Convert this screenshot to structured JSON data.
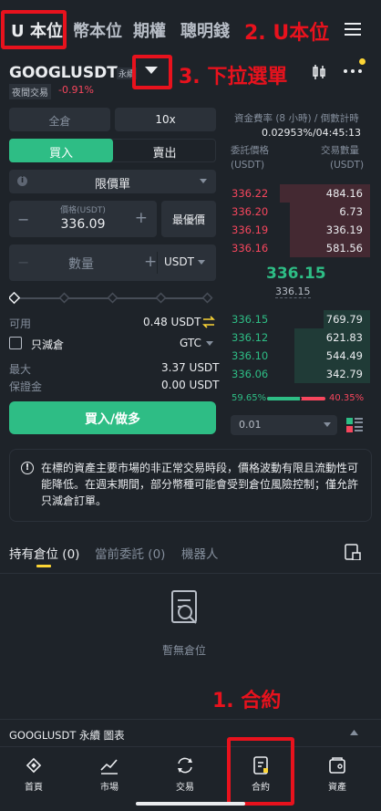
{
  "top_tabs": [
    "U 本位",
    "幣本位",
    "期權",
    "聰明錢"
  ],
  "annotations": {
    "a1": "1. 合約",
    "a2": "2. U本位",
    "a3": "3. 下拉選單"
  },
  "symbol": {
    "name": "GOOGLUSDT",
    "type": "永續",
    "session": "夜間交易",
    "change": "-0.91%"
  },
  "order_form": {
    "margin_mode": "全倉",
    "leverage": "10x",
    "buy_tab": "買入",
    "sell_tab": "賣出",
    "order_type": "限價單",
    "price_label": "價格(USDT)",
    "price_value": "336.09",
    "best_price": "最優價",
    "qty_placeholder": "數量",
    "qty_unit": "USDT",
    "available_label": "可用",
    "available_value": "0.48 USDT",
    "reduce_only": "只減倉",
    "tif": "GTC",
    "max_label": "最大",
    "max_value": "3.37 USDT",
    "margin_label": "保證金",
    "margin_value": "0.00 USDT",
    "submit": "買入/做多"
  },
  "orderbook": {
    "funding_label": "資金費率 (8 小時) / 倒數計時",
    "funding_value": "0.02953%/04:45:13",
    "price_header": "委託價格",
    "price_unit": "(USDT)",
    "qty_header": "交易數量",
    "qty_unit": "(USDT)",
    "asks": [
      {
        "price": "336.22",
        "qty": "484.16",
        "depth": 0.62
      },
      {
        "price": "336.20",
        "qty": "6.73",
        "depth": 0.55
      },
      {
        "price": "336.19",
        "qty": "336.19",
        "depth": 0.55
      },
      {
        "price": "336.16",
        "qty": "581.56",
        "depth": 0.55
      }
    ],
    "last_price": "336.15",
    "mark_price": "336.15",
    "bids": [
      {
        "price": "336.15",
        "qty": "769.79",
        "depth": 0.32
      },
      {
        "price": "336.12",
        "qty": "621.83",
        "depth": 0.52
      },
      {
        "price": "336.10",
        "qty": "544.49",
        "depth": 0.52
      },
      {
        "price": "336.06",
        "qty": "342.79",
        "depth": 0.52
      }
    ],
    "buy_ratio": "59.65%",
    "sell_ratio": "40.35%",
    "buy_fraction": 0.5965,
    "precision": "0.01"
  },
  "notice": "在標的資產主要市場的非正常交易時段，價格波動有限且流動性可能降低。在週末期間，部分幣種可能會受到倉位風險控制；僅允許只減倉訂單。",
  "positions": {
    "tabs": [
      {
        "label": "持有倉位",
        "count": "(0)"
      },
      {
        "label": "當前委託",
        "count": "(0)"
      },
      {
        "label": "機器人",
        "count": ""
      }
    ],
    "empty": "暫無倉位"
  },
  "chart_bar": "GOOGLUSDT 永續 圖表",
  "bottom_nav": [
    "首頁",
    "市場",
    "交易",
    "合約",
    "資產"
  ],
  "colors": {
    "accent": "#2ebd85",
    "down": "#f6465d",
    "annotation": "#e8121d",
    "warning": "#fcd535"
  }
}
